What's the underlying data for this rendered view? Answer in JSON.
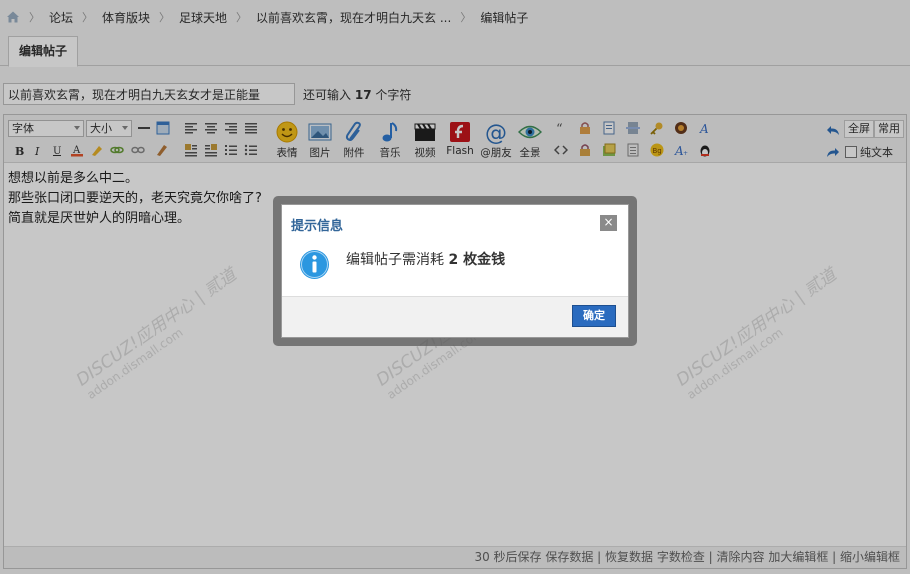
{
  "breadcrumb": {
    "items": [
      "论坛",
      "体育版块",
      "足球天地",
      "以前喜欢玄霄，现在才明白九天玄 ...",
      "编辑帖子"
    ]
  },
  "tab": {
    "label": "编辑帖子"
  },
  "subject": {
    "value": "以前喜欢玄霄，现在才明白九天玄女才是正能量",
    "remain_prefix": "还可输入",
    "remain_count": "17",
    "remain_suffix": "个字符"
  },
  "toolbar": {
    "font_label": "字体",
    "size_label": "大小",
    "big_buttons": [
      "表情",
      "图片",
      "附件",
      "音乐",
      "视频",
      "Flash",
      "@朋友",
      "全景"
    ],
    "fullscreen": "全屏",
    "common": "常用",
    "plain_text": "纯文本"
  },
  "content": {
    "lines": [
      "想想以前是多么中二。",
      "那些张口闭口要逆天的，老天究竟欠你啥了?",
      "简直就是厌世妒人的阴暗心理。"
    ]
  },
  "statusbar": {
    "text": "30 秒后保存 保存数据 | 恢复数据    字数检查 | 清除内容    加大编辑框 | 缩小编辑框"
  },
  "dialog": {
    "title": "提示信息",
    "close": "×",
    "message_prefix": "编辑帖子需消耗",
    "message_bold": "2 枚金钱",
    "confirm": "确定"
  },
  "watermark": {
    "main": "DISCUZ!应用中心 | 贰道",
    "sub": "addon.dismall.com"
  },
  "colors": {
    "accent": "#2a6bbf",
    "title": "#336699",
    "info_icon": "#2b97e0"
  }
}
